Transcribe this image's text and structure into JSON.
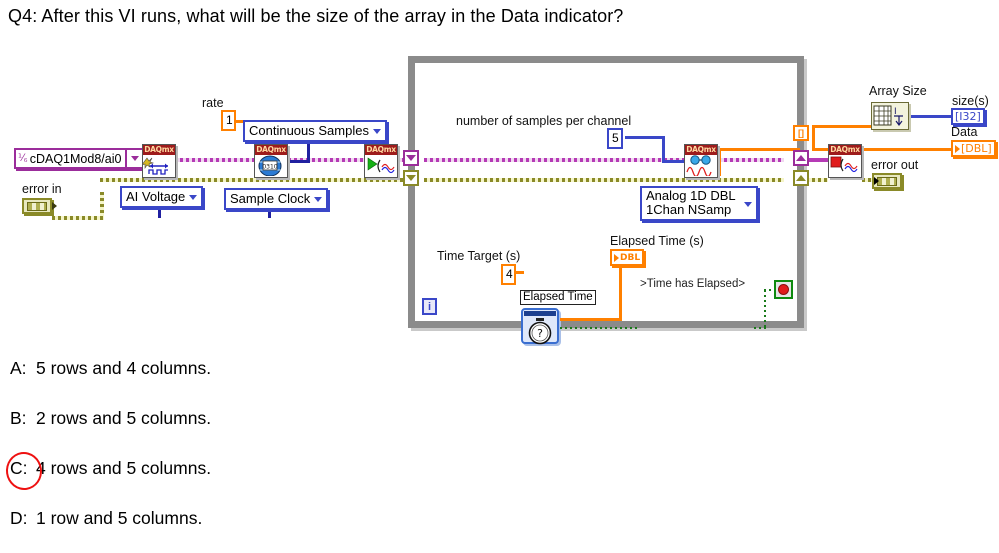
{
  "question": {
    "text": "Q4:  After this VI runs, what will be the size of the array in the Data indicator?"
  },
  "answers": [
    {
      "letter": "A:",
      "text": "5 rows and 4 columns.",
      "marked": false
    },
    {
      "letter": "B:",
      "text": "2 rows and 5 columns.",
      "marked": false
    },
    {
      "letter": "C:",
      "text": "4 rows and 5 columns.",
      "marked": true
    },
    {
      "letter": "D:",
      "text": "1 row and 5 columns.",
      "marked": false
    }
  ],
  "annotation": {
    "circle_color": "#ee1111",
    "circled_answer": "C:"
  },
  "diagram": {
    "type": "labview-block-diagram",
    "controls": {
      "physical_channel": "cDAQ1Mod8/ai0",
      "error_in_label": "error in",
      "error_out_label": "error out"
    },
    "constants": {
      "rate_label": "rate",
      "rate_value": "1",
      "samples_label": "number of samples per channel",
      "samples_value": "5",
      "time_target_label": "Time Target (s)",
      "time_target_value": "4"
    },
    "rings": {
      "measurement_type": "AI Voltage",
      "timing_type": "Sample Clock",
      "sample_mode": "Continuous Samples",
      "read_type_line1": "Analog 1D DBL",
      "read_type_line2": "1Chan NSamp"
    },
    "nodes": {
      "create_channel": "DAQmx",
      "timing": "DAQmx",
      "start_task": "DAQmx",
      "read": "DAQmx",
      "clear_task": "DAQmx",
      "array_size_label": "Array Size",
      "elapsed_time_label": "Elapsed Time"
    },
    "indicators": {
      "size_label": "size(s)",
      "size_type": "[I32]",
      "data_label": "Data",
      "data_type": "[DBL]",
      "elapsed_label": "Elapsed Time (s)",
      "elapsed_type": "DBL"
    },
    "wire_labels": {
      "time_has_elapsed": ">Time has Elapsed>"
    },
    "loop": {
      "iteration_terminal": "i",
      "index_tunnel": "[]"
    },
    "colors": {
      "task_wire": "#b53ab5",
      "error_wire": "#8a8a28",
      "dbl_wire": "#ff8000",
      "i32_wire": "#3a47c8",
      "bool_wire": "#1a7a1a",
      "loop_border": "#8b8b8b",
      "daqmx_banner": "#9e1b1b"
    }
  }
}
